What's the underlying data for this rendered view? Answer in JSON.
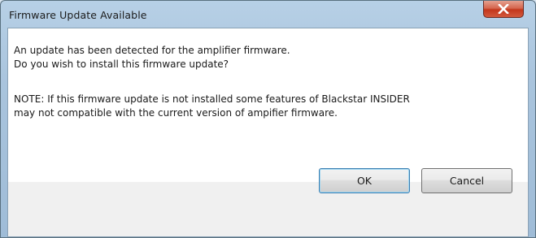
{
  "window": {
    "title": "Firmware Update Available",
    "close_icon": "close-x-icon"
  },
  "message": {
    "line1": "An update has been detected for the amplifier firmware.",
    "line2": "Do you wish to install this firmware update?",
    "note_line1": "NOTE: If this firmware update is not installed some features of Blackstar INSIDER",
    "note_line2": "may not compatible with the current version of ampifier firmware."
  },
  "buttons": {
    "ok_label": "OK",
    "cancel_label": "Cancel"
  },
  "colors": {
    "close_button": "#c3371c",
    "title_bar": "#a9c4dd",
    "footer": "#f0f0f0"
  }
}
